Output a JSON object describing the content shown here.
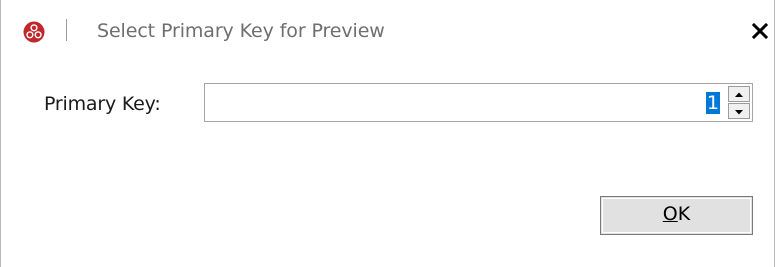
{
  "window": {
    "title": "Select Primary Key for Preview",
    "app_icon": "red-triple-circle-logo-icon",
    "close_icon": "close-icon",
    "close_glyph": "✕"
  },
  "form": {
    "primary_key_label": "Primary Key:",
    "primary_key_value": "1",
    "spin_up_icon": "spin-up-arrow-icon",
    "spin_down_icon": "spin-down-arrow-icon"
  },
  "actions": {
    "ok_mnemonic": "O",
    "ok_rest": "K"
  },
  "colors": {
    "selection": "#0078d7",
    "icon_red": "#c0282d"
  }
}
